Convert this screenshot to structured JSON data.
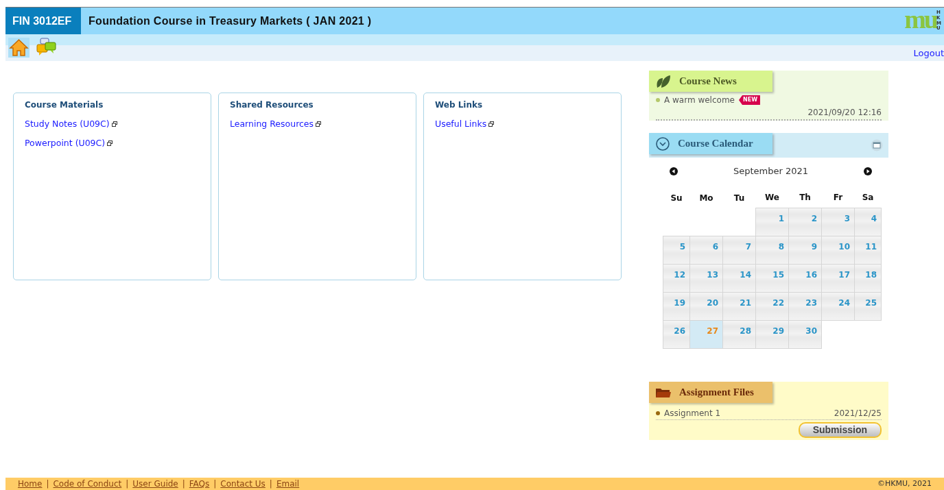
{
  "header": {
    "course_code": "FIN 3012EF",
    "course_title": "Foundation Course in Treasury Markets ( JAN 2021 )",
    "logo": {
      "mark": "mu",
      "caption": "HKMU"
    }
  },
  "toolbar": {
    "logout": "Logout"
  },
  "panels": [
    {
      "title": "Course Materials",
      "links": [
        "Study Notes (U09C)",
        "Powerpoint (U09C)"
      ]
    },
    {
      "title": "Shared Resources",
      "links": [
        "Learning Resources"
      ]
    },
    {
      "title": "Web Links",
      "links": [
        "Useful Links"
      ]
    }
  ],
  "news": {
    "title": "Course News",
    "items": [
      {
        "title": "A warm welcome",
        "badge": "NEW",
        "time": "2021/09/20 12:16"
      }
    ]
  },
  "calendar": {
    "title": "Course Calendar",
    "month": "September 2021",
    "weekdays": [
      "Su",
      "Mo",
      "Tu",
      "We",
      "Th",
      "Fr",
      "Sa"
    ],
    "weeks": [
      [
        {
          "kind": "blank"
        },
        {
          "kind": "blank"
        },
        {
          "kind": "blank"
        },
        {
          "day": "1",
          "selected": false
        },
        {
          "day": "2",
          "selected": false
        },
        {
          "day": "3",
          "selected": false
        },
        {
          "day": "4",
          "selected": false
        }
      ],
      [
        {
          "day": "5",
          "selected": false
        },
        {
          "day": "6",
          "selected": false
        },
        {
          "day": "7",
          "selected": false
        },
        {
          "day": "8",
          "selected": false
        },
        {
          "day": "9",
          "selected": false
        },
        {
          "day": "10",
          "selected": false
        },
        {
          "day": "11",
          "selected": false
        }
      ],
      [
        {
          "day": "12",
          "selected": false
        },
        {
          "day": "13",
          "selected": false
        },
        {
          "day": "14",
          "selected": false
        },
        {
          "day": "15",
          "selected": false
        },
        {
          "day": "16",
          "selected": false
        },
        {
          "day": "17",
          "selected": false
        },
        {
          "day": "18",
          "selected": false
        }
      ],
      [
        {
          "day": "19",
          "selected": false
        },
        {
          "day": "20",
          "selected": false
        },
        {
          "day": "21",
          "selected": false
        },
        {
          "day": "22",
          "selected": false
        },
        {
          "day": "23",
          "selected": false
        },
        {
          "day": "24",
          "selected": false
        },
        {
          "day": "25",
          "selected": false
        }
      ],
      [
        {
          "day": "26",
          "selected": false
        },
        {
          "day": "27",
          "selected": true
        },
        {
          "day": "28",
          "selected": false
        },
        {
          "day": "29",
          "selected": false
        },
        {
          "day": "30",
          "selected": false
        },
        {
          "kind": "blank"
        },
        {
          "kind": "blank"
        }
      ]
    ]
  },
  "assignments": {
    "title": "Assignment Files",
    "items": [
      {
        "title": "Assignment 1",
        "date": "2021/12/25"
      }
    ],
    "button": "Submission"
  },
  "footer": {
    "separator": "|",
    "links": [
      "Home",
      "Code of Conduct",
      "User Guide",
      "FAQs",
      "Contact Us",
      "Email"
    ],
    "copyright": "©HKMU, 2021"
  }
}
